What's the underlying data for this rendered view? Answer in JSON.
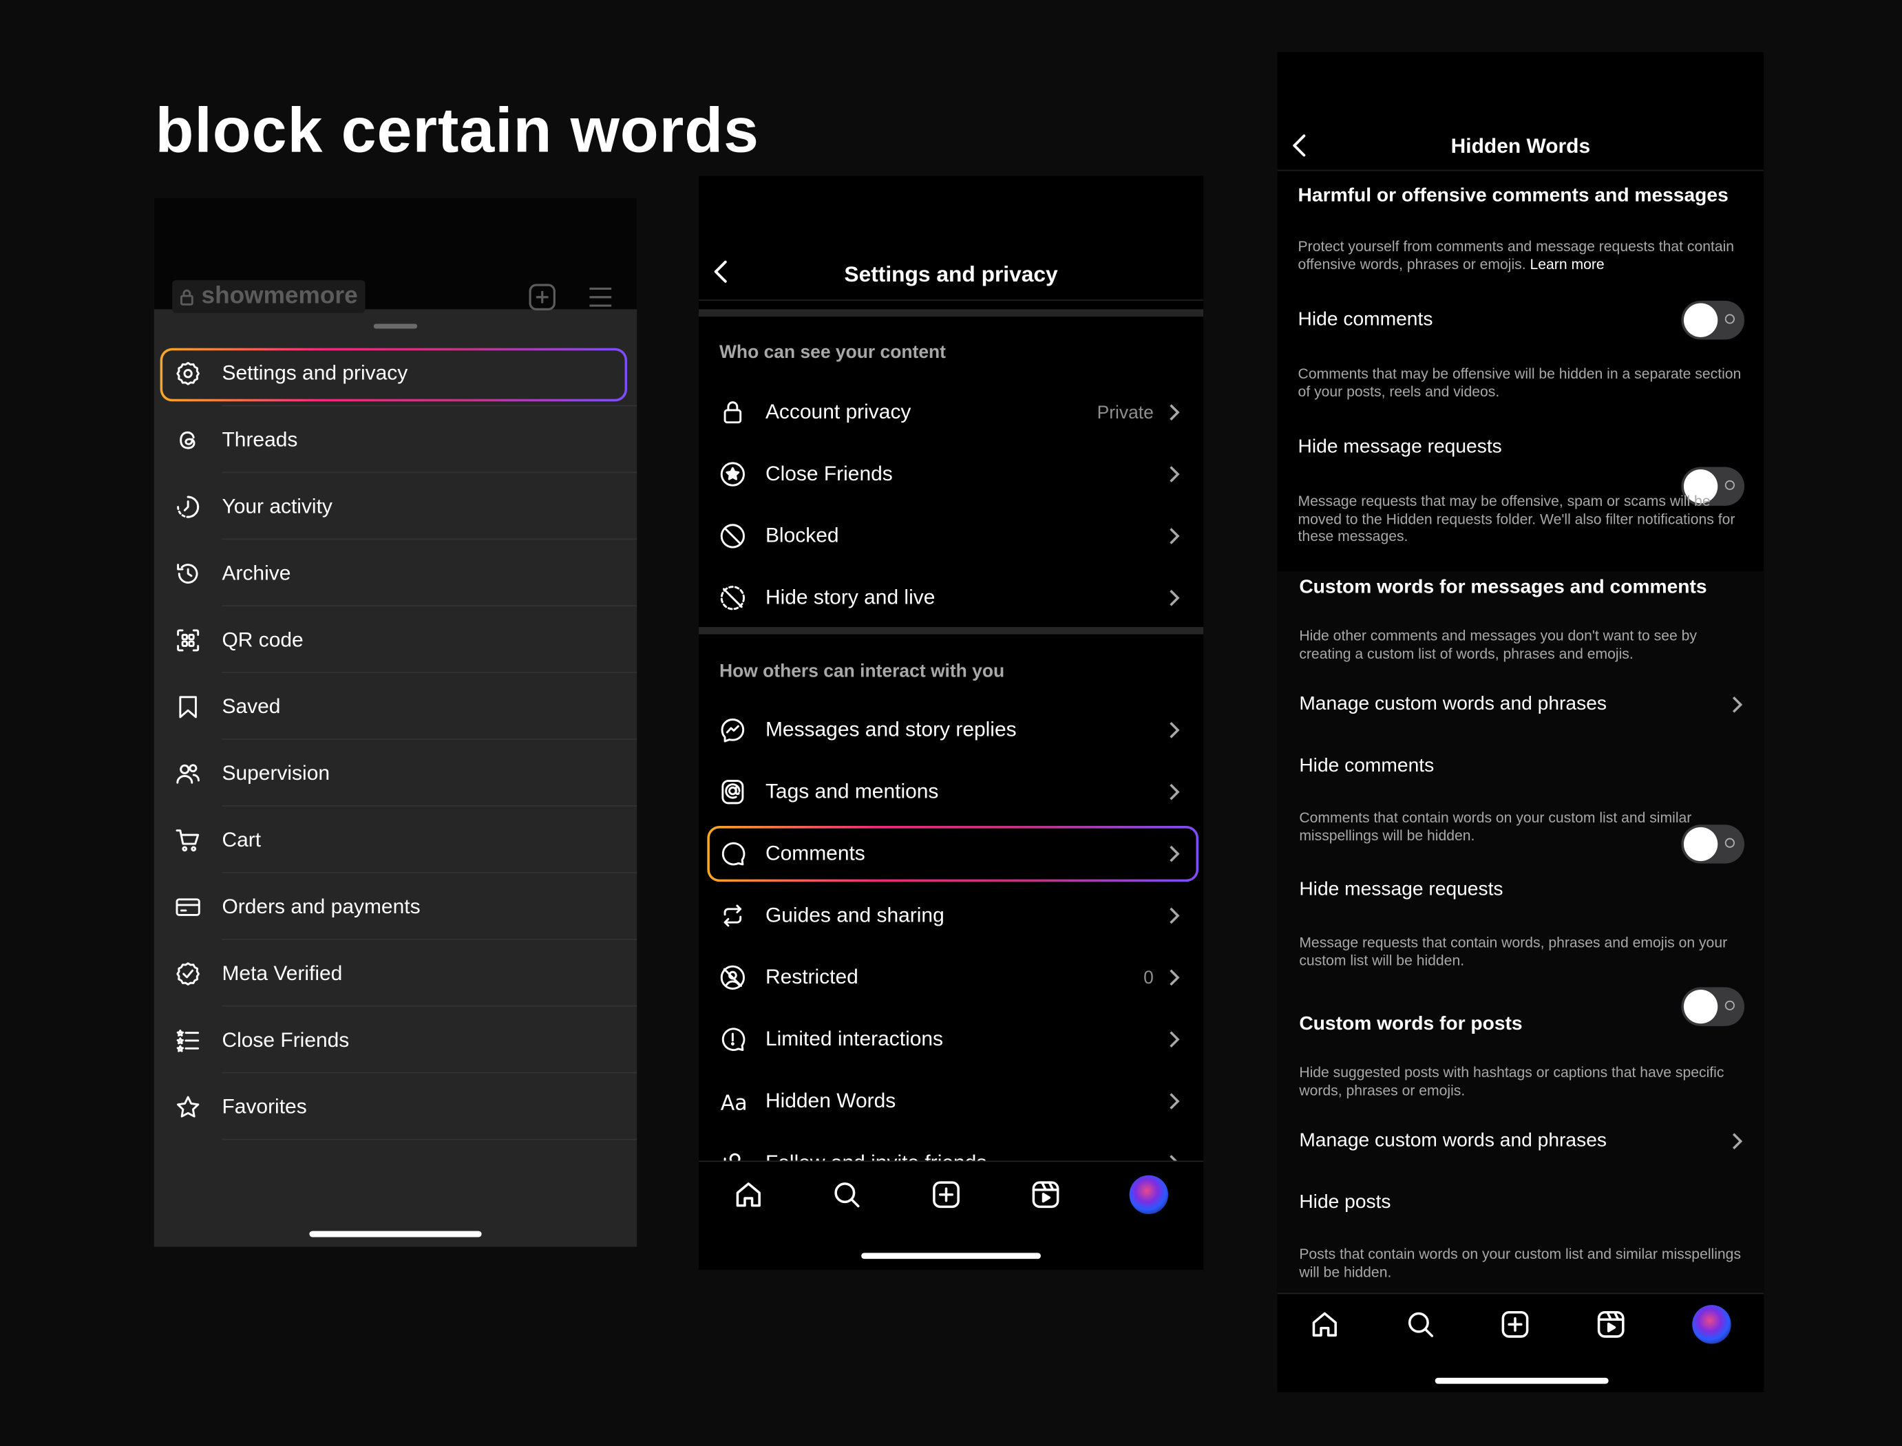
{
  "page": {
    "title": "block certain words"
  },
  "panel1": {
    "username": "showmemore",
    "menu": [
      {
        "label": "Settings and privacy",
        "icon": "gear-icon"
      },
      {
        "label": "Threads",
        "icon": "threads-icon"
      },
      {
        "label": "Your activity",
        "icon": "activity-icon"
      },
      {
        "label": "Archive",
        "icon": "archive-icon"
      },
      {
        "label": "QR code",
        "icon": "qr-code-icon"
      },
      {
        "label": "Saved",
        "icon": "bookmark-icon"
      },
      {
        "label": "Supervision",
        "icon": "supervision-icon"
      },
      {
        "label": "Cart",
        "icon": "cart-icon"
      },
      {
        "label": "Orders and payments",
        "icon": "card-icon"
      },
      {
        "label": "Meta Verified",
        "icon": "verified-badge-icon"
      },
      {
        "label": "Close Friends",
        "icon": "close-friends-list-icon"
      },
      {
        "label": "Favorites",
        "icon": "star-icon"
      }
    ]
  },
  "panel2": {
    "header": "Settings and privacy",
    "section1": {
      "label": "Who can see your content",
      "rows": [
        {
          "label": "Account privacy",
          "value": "Private",
          "icon": "lock-icon"
        },
        {
          "label": "Close Friends",
          "value": "",
          "icon": "close-friends-star-icon"
        },
        {
          "label": "Blocked",
          "value": "",
          "icon": "blocked-icon"
        },
        {
          "label": "Hide story and live",
          "value": "",
          "icon": "hide-story-icon"
        }
      ]
    },
    "section2": {
      "label": "How others can interact with you",
      "rows": [
        {
          "label": "Messages and story replies",
          "value": "",
          "icon": "messenger-icon"
        },
        {
          "label": "Tags and mentions",
          "value": "",
          "icon": "at-icon"
        },
        {
          "label": "Comments",
          "value": "",
          "icon": "comment-icon"
        },
        {
          "label": "Guides and sharing",
          "value": "",
          "icon": "share-arrows-icon"
        },
        {
          "label": "Restricted",
          "value": "0",
          "icon": "restricted-icon"
        },
        {
          "label": "Limited interactions",
          "value": "",
          "icon": "limited-icon"
        },
        {
          "label": "Hidden Words",
          "value": "",
          "icon": "hidden-words-icon"
        },
        {
          "label": "Follow and invite friends",
          "value": "",
          "icon": "add-person-icon"
        }
      ]
    }
  },
  "panel3": {
    "header": "Hidden Words",
    "harmful": {
      "title": "Harmful or offensive comments and messages",
      "desc": "Protect yourself from comments and message requests that contain offensive words, phrases or emojis.",
      "learn_more": "Learn more",
      "hide_comments": "Hide comments",
      "hide_comments_desc": "Comments that may be offensive will be hidden in a separate section of your posts, reels and videos.",
      "hide_msg": "Hide message requests",
      "hide_msg_desc": "Message requests that may be offensive, spam or scams will be moved to the Hidden requests folder. We'll also filter notifications for these messages."
    },
    "custom": {
      "title": "Custom words for messages and comments",
      "desc": "Hide other comments and messages you don't want to see by creating a custom list of words, phrases and emojis.",
      "manage": "Manage custom words and phrases",
      "hide_comments": "Hide comments",
      "hide_comments_desc": "Comments that contain words on your custom list and similar misspellings will be hidden.",
      "hide_msg": "Hide message requests",
      "hide_msg_desc": "Message requests that contain words, phrases and emojis on your custom list will be hidden."
    },
    "posts": {
      "title": "Custom words for posts",
      "desc": "Hide suggested posts with hashtags or captions that have specific words, phrases or emojis.",
      "manage": "Manage custom words and phrases",
      "hide_posts": "Hide posts",
      "hide_posts_desc": "Posts that contain words on your custom list and similar misspellings will be hidden."
    }
  },
  "colors": {
    "highlight_gradient": [
      "#f9a825",
      "#ee2a7b",
      "#c13584",
      "#7e4dfc"
    ],
    "panel_bg": "#262626"
  }
}
